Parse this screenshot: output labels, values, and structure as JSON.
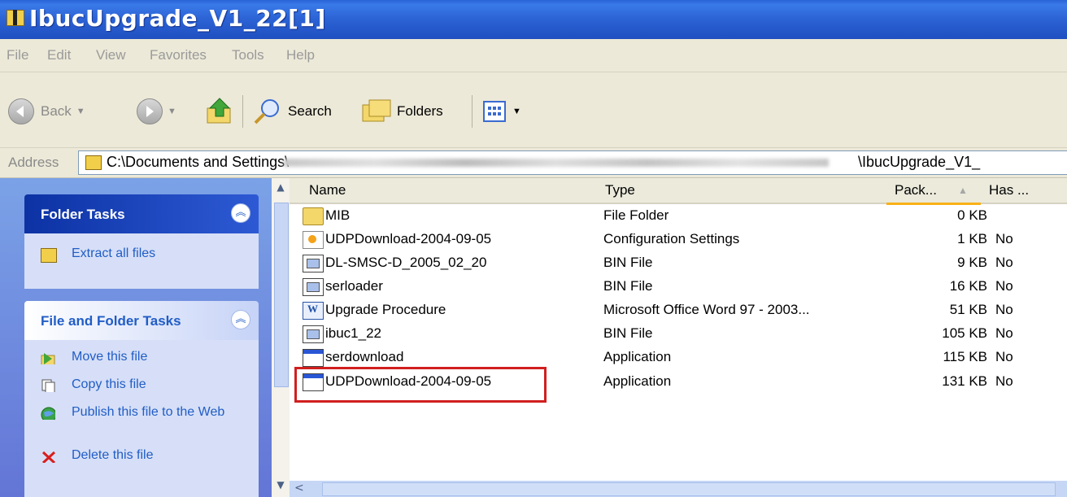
{
  "window": {
    "title": "IbucUpgrade_V1_22[1]"
  },
  "menu": [
    "File",
    "Edit",
    "View",
    "Favorites",
    "Tools",
    "Help"
  ],
  "toolbar": {
    "back": "Back",
    "search": "Search",
    "folders": "Folders"
  },
  "address": {
    "label": "Address",
    "start": "C:\\Documents and Settings\\",
    "end": "\\IbucUpgrade_V1_"
  },
  "panes": {
    "folder_tasks": {
      "title": "Folder Tasks",
      "items": [
        "Extract all files"
      ]
    },
    "file_folder_tasks": {
      "title": "File and Folder Tasks",
      "items": [
        "Move this file",
        "Copy this file",
        "Publish this file to the Web",
        "Delete this file"
      ]
    }
  },
  "columns": {
    "name": "Name",
    "type": "Type",
    "packed": "Pack...",
    "has": "Has ..."
  },
  "files": [
    {
      "name": "MIB",
      "type": "File Folder",
      "size": "0 KB",
      "has": "",
      "icon": "folder-icon"
    },
    {
      "name": "UDPDownload-2004-09-05",
      "type": "Configuration Settings",
      "size": "1 KB",
      "has": "No",
      "icon": "config-file-icon"
    },
    {
      "name": "DL-SMSC-D_2005_02_20",
      "type": "BIN File",
      "size": "9 KB",
      "has": "No",
      "icon": "bin-file-icon"
    },
    {
      "name": "serloader",
      "type": "BIN File",
      "size": "16 KB",
      "has": "No",
      "icon": "bin-file-icon"
    },
    {
      "name": "Upgrade Procedure",
      "type": "Microsoft Office Word 97 - 2003...",
      "size": "51 KB",
      "has": "No",
      "icon": "word-doc-icon"
    },
    {
      "name": "ibuc1_22",
      "type": "BIN File",
      "size": "105 KB",
      "has": "No",
      "icon": "bin-file-icon"
    },
    {
      "name": "serdownload",
      "type": "Application",
      "size": "115 KB",
      "has": "No",
      "icon": "application-icon"
    },
    {
      "name": "UDPDownload-2004-09-05",
      "type": "Application",
      "size": "131 KB",
      "has": "No",
      "icon": "application-icon"
    }
  ],
  "colors": {
    "title_bar": "#2b62d4",
    "highlight_box": "#d11f1f",
    "task_link": "#215dc6"
  }
}
